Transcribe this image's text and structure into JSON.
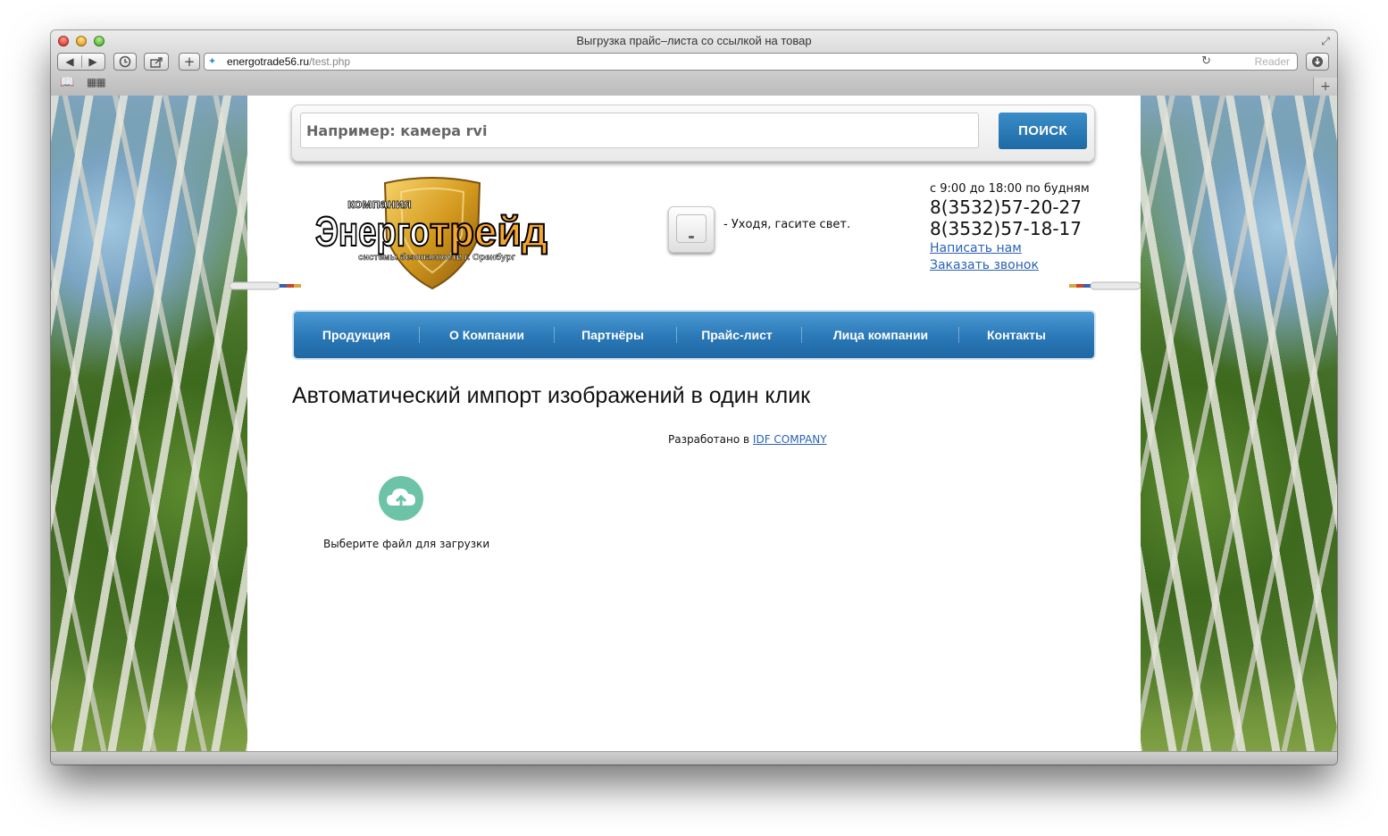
{
  "window": {
    "title": "Выгрузка прайс–листа со ссылкой на товар",
    "url_host": "energotrade56.ru",
    "url_path": "/test.php",
    "reader_label": "Reader",
    "back_icon": "◀",
    "forward_icon": "▶",
    "add_icon": "+",
    "new_tab_icon": "+"
  },
  "search": {
    "placeholder": "Например: камера rvi",
    "button_label": "ПОИСК"
  },
  "logo": {
    "top_word": "компания",
    "main_word_1": "Энерго",
    "main_word_2": "трейд",
    "tagline": "системы безопасности г. Оренбург"
  },
  "slogan": "- Уходя, гасите свет.",
  "contacts": {
    "hours": "с 9:00 до 18:00 по будням",
    "phone1": "8(3532)57-20-27",
    "phone2": "8(3532)57-18-17",
    "write_link": "Написать нам",
    "call_link": "Заказать звонок"
  },
  "nav": {
    "items": [
      {
        "label": "Продукция"
      },
      {
        "label": "О Компании"
      },
      {
        "label": "Партнёры"
      },
      {
        "label": "Прайс-лист"
      },
      {
        "label": "Лица компании"
      },
      {
        "label": "Контакты"
      }
    ]
  },
  "main": {
    "heading": "Автоматический импорт изображений в один клик",
    "credit_prefix": "Разработано в ",
    "credit_link": "IDF COMPANY",
    "upload_label": "Выберите файл для загрузки"
  },
  "colors": {
    "nav_blue": "#2a78b7",
    "search_button": "#1d6aa5",
    "link": "#2a62b5",
    "upload_icon": "#6cc3a7"
  }
}
